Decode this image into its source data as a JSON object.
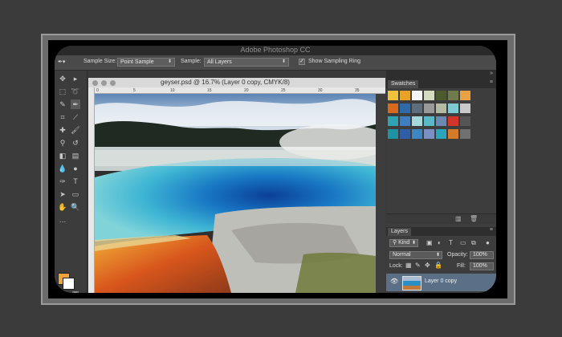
{
  "app": {
    "title": "Adobe Photoshop CC"
  },
  "options_bar": {
    "sample_size_label": "Sample Size:",
    "sample_size_value": "Point Sample",
    "sample_label": "Sample:",
    "sample_value": "All Layers",
    "show_ring_label": "Show Sampling Ring",
    "show_ring_checked": true
  },
  "document": {
    "title": "geyser.psd @ 16.7% (Layer 0 copy, CMYK/8)",
    "ruler_ticks": [
      "0",
      "5",
      "10",
      "15",
      "20",
      "25",
      "30",
      "35"
    ]
  },
  "colors": {
    "foreground": "#f2a33a",
    "background": "#ffffff",
    "selected_layer": "#5b6f86"
  },
  "swatches": {
    "tab_label": "Swatches",
    "colors": [
      "#f0c23a",
      "#e8a224",
      "#f5f5f5",
      "#d3dcc0",
      "#4d5a2e",
      "#707b4b",
      "#e9a143",
      "#d86a1e",
      "#2f6aa6",
      "#5f6e7c",
      "#9a9a9a",
      "#b5bba3",
      "#7ecad2",
      "#c9c9c9",
      "#2fa3b3",
      "#3f7fc0",
      "#a5d8da",
      "#5bb8c7",
      "#6a89b3",
      "#d3342a",
      "#555555",
      "#1e93a4",
      "#2d5ea6",
      "#3e86c2",
      "#7a90c2",
      "#2aa5b9",
      "#d57a28",
      "#707070"
    ]
  },
  "layers": {
    "tab_label": "Layers",
    "kind_label": "Kind",
    "blend_mode": "Normal",
    "opacity_label": "Opacity:",
    "opacity_value": "100%",
    "lock_label": "Lock:",
    "fill_label": "Fill:",
    "fill_value": "100%",
    "items": [
      {
        "name": "Layer 0 copy",
        "visible": true
      }
    ]
  }
}
